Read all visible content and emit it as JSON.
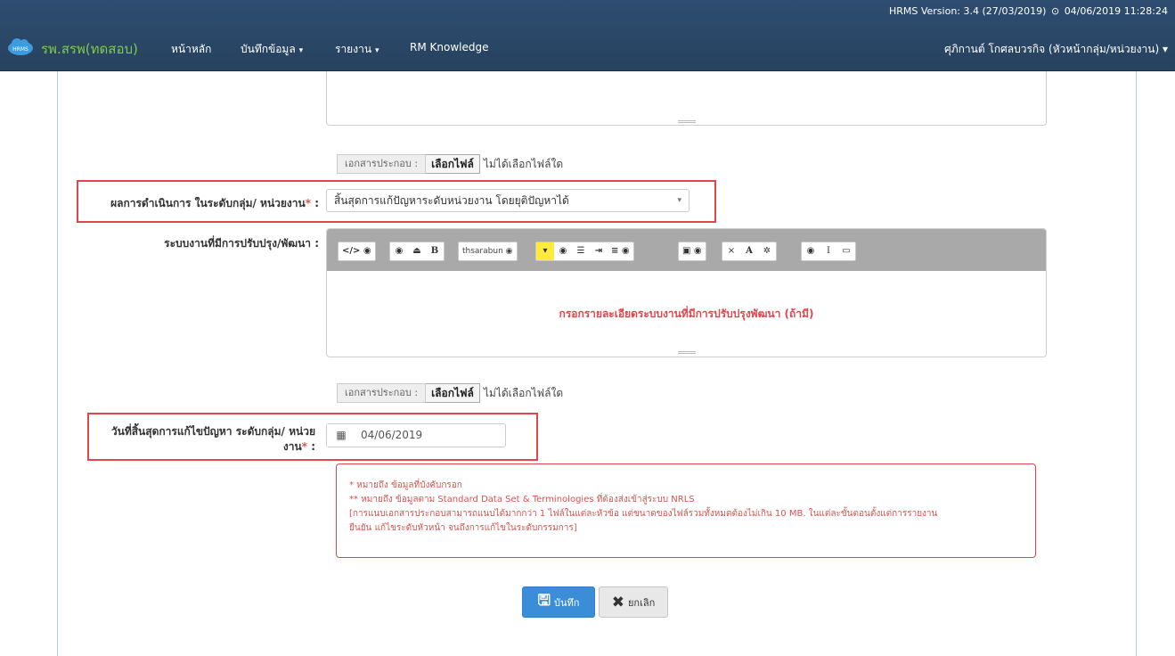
{
  "header": {
    "version": "HRMS Version: 3.4 (27/03/2019)",
    "datetime": "04/06/2019 11:28:24",
    "logo_text": "HRMS",
    "brand": "รพ.สรพ(ทดสอบ)",
    "nav": [
      "หน้าหลัก",
      "บันทึกข้อมูล",
      "รายงาน",
      "RM Knowledge"
    ],
    "user": "ศุภิกานต์ โกศลบวรกิจ (หัวหน้ากลุ่ม/หน่วยงาน)"
  },
  "attachments": {
    "label": "เอกสารประกอบ :",
    "button": "เลือกไฟล์",
    "status": "ไม่ได้เลือกไฟล์ใด"
  },
  "form": {
    "result_label": "ผลการดำเนินการ ในระดับกลุ่ม/ หน่วยงาน",
    "result_value": "สิ้นสุดการแก้ปัญหาระดับหน่วยงาน โดยยุติปัญหาได้",
    "system_label": "ระบบงานที่มีการปรับปรุง/พัฒนา :",
    "system_placeholder": "กรอกรายละเอียดระบบงานที่มีการปรับปรุงพัฒนา (ถ้ามี)",
    "end_date_label_line1": "วันที่สิ้นสุดการแก้ไขปัญหา ระดับกลุ่ม/ หน่วย",
    "end_date_label_line2": "งาน",
    "end_date_value": "04/06/2019",
    "required_mark": "*",
    "colon": " :"
  },
  "toolbar": {
    "code": "</>",
    "bold": "B",
    "font": "thsarabun",
    "close": "×",
    "font_color": "A",
    "italic": "I"
  },
  "notes": [
    "* หมายถึง ข้อมูลที่บังคับกรอก",
    "** หมายถึง ข้อมูลตาม Standard Data Set & Terminologies ที่ต้องส่งเข้าสู่ระบบ NRLS",
    "[การแนบเอกสารประกอบสามารถแนบได้มากกว่า 1 ไฟล์ในแต่ละหัวข้อ แต่ขนาดของไฟล์รวมทั้งหมดต้องไม่เกิน 10 MB. ในแต่ละขั้นตอนตั้งแต่การรายงาน",
    "ยืนยัน แก้ไขระดับหัวหน้า จนถึงการแก้ไขในระดับกรรมการ]"
  ],
  "actions": {
    "save": "บันทึก",
    "cancel": "ยกเลิก"
  },
  "colors": {
    "navbar": "#2d4a6b",
    "brand": "#7fc94e",
    "highlight_box": "#e0474c",
    "save_button": "#3c8dd8"
  }
}
